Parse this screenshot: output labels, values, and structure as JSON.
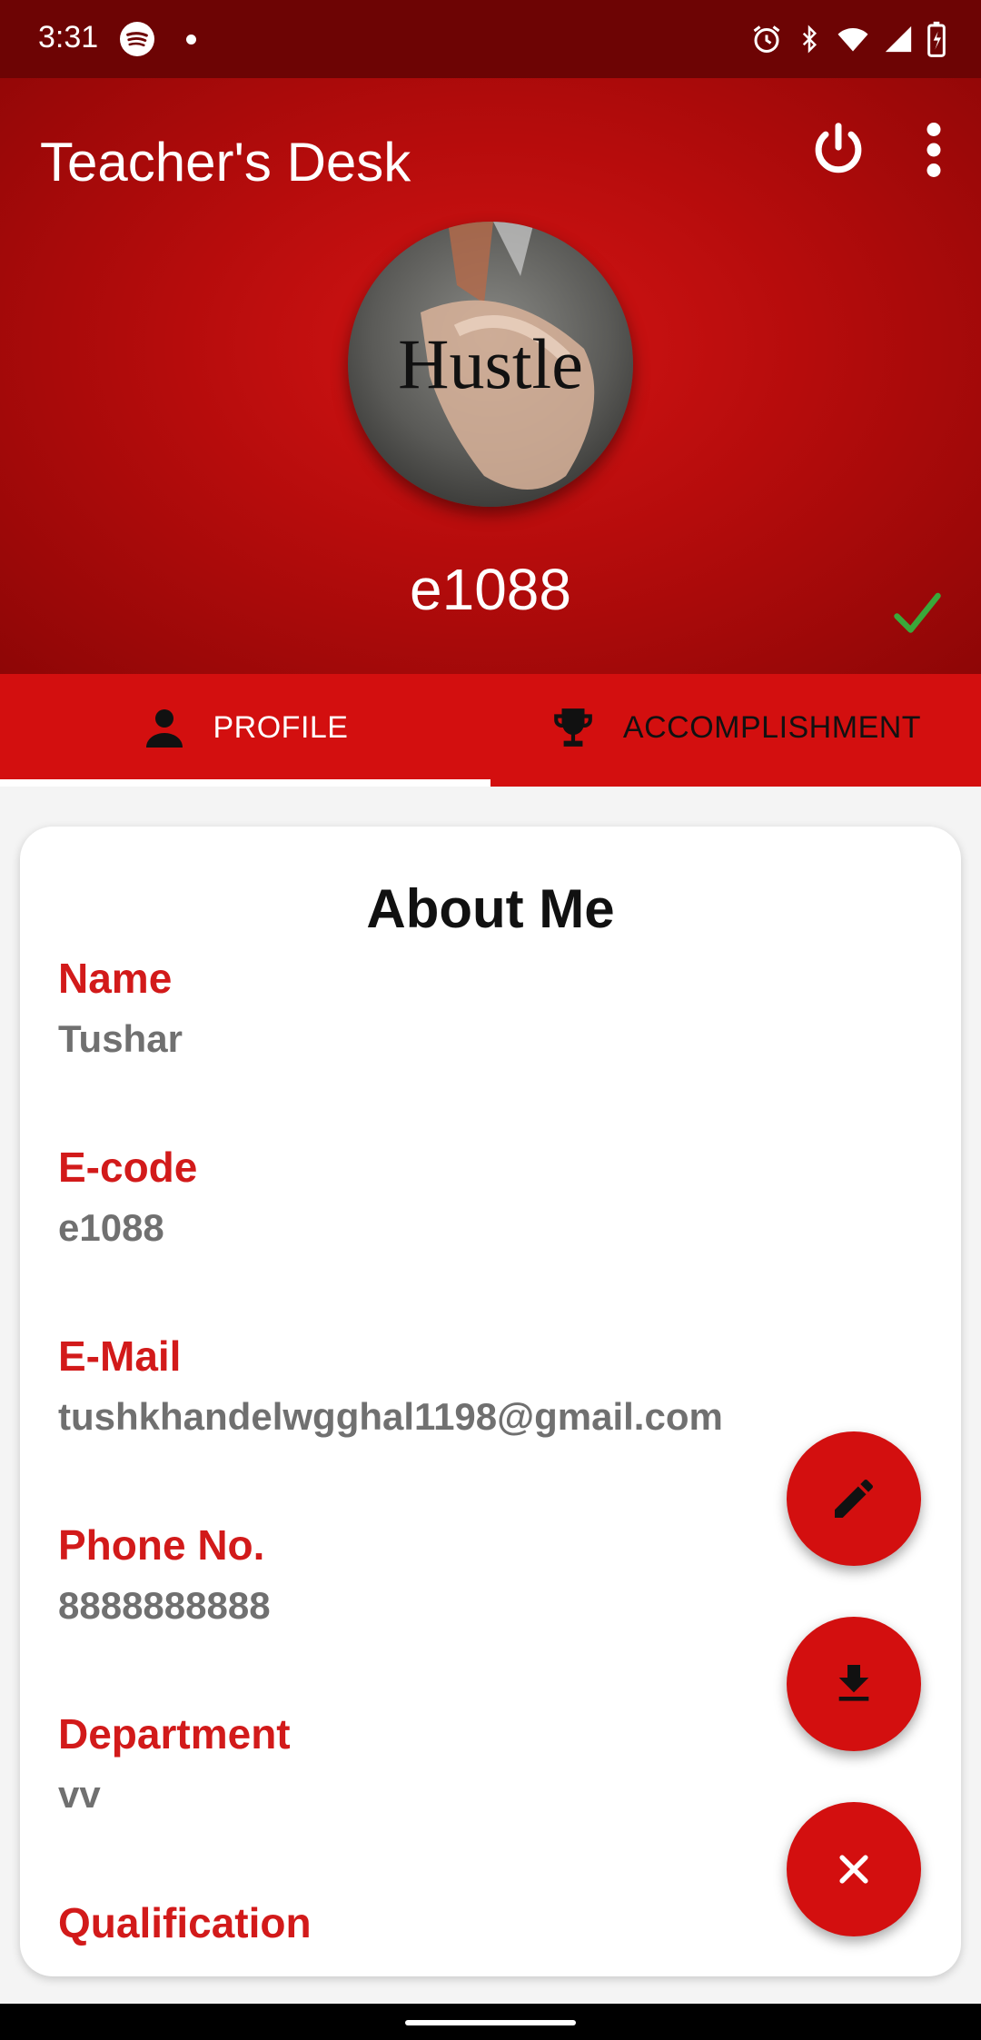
{
  "status_bar": {
    "time": "3:31",
    "icons": [
      "spotify-icon",
      "notification-dot",
      "alarm-icon",
      "bluetooth-icon",
      "wifi-icon",
      "signal-icon",
      "battery-icon"
    ]
  },
  "app_bar": {
    "title": "Teacher's Desk",
    "actions": [
      "power-icon",
      "more-vert-icon"
    ]
  },
  "profile": {
    "avatar_text": "Hustle",
    "username": "e1088",
    "verified_icon": "check-icon"
  },
  "tabs": [
    {
      "label": "PROFILE",
      "icon": "person-icon",
      "selected": true
    },
    {
      "label": "ACCOMPLISHMENT",
      "icon": "trophy-icon",
      "selected": false
    }
  ],
  "about": {
    "title": "About Me",
    "fields": [
      {
        "label": "Name",
        "value": "Tushar"
      },
      {
        "label": "E-code",
        "value": "e1088"
      },
      {
        "label": "E-Mail",
        "value": "tushkhandelwgghal1198@gmail.com"
      },
      {
        "label": "Phone No.",
        "value": "8888888888"
      },
      {
        "label": "Department",
        "value": "vv"
      },
      {
        "label": "Qualification",
        "value": ""
      }
    ]
  },
  "fabs": [
    "edit-icon",
    "download-icon",
    "close-icon"
  ],
  "colors": {
    "status_bar": "#6d0404",
    "header_primary": "#b60c0c",
    "tab_bar": "#d30f0f",
    "label_red": "#d21a1a",
    "value_gray": "#707070",
    "verified_green": "#3aa83a"
  }
}
